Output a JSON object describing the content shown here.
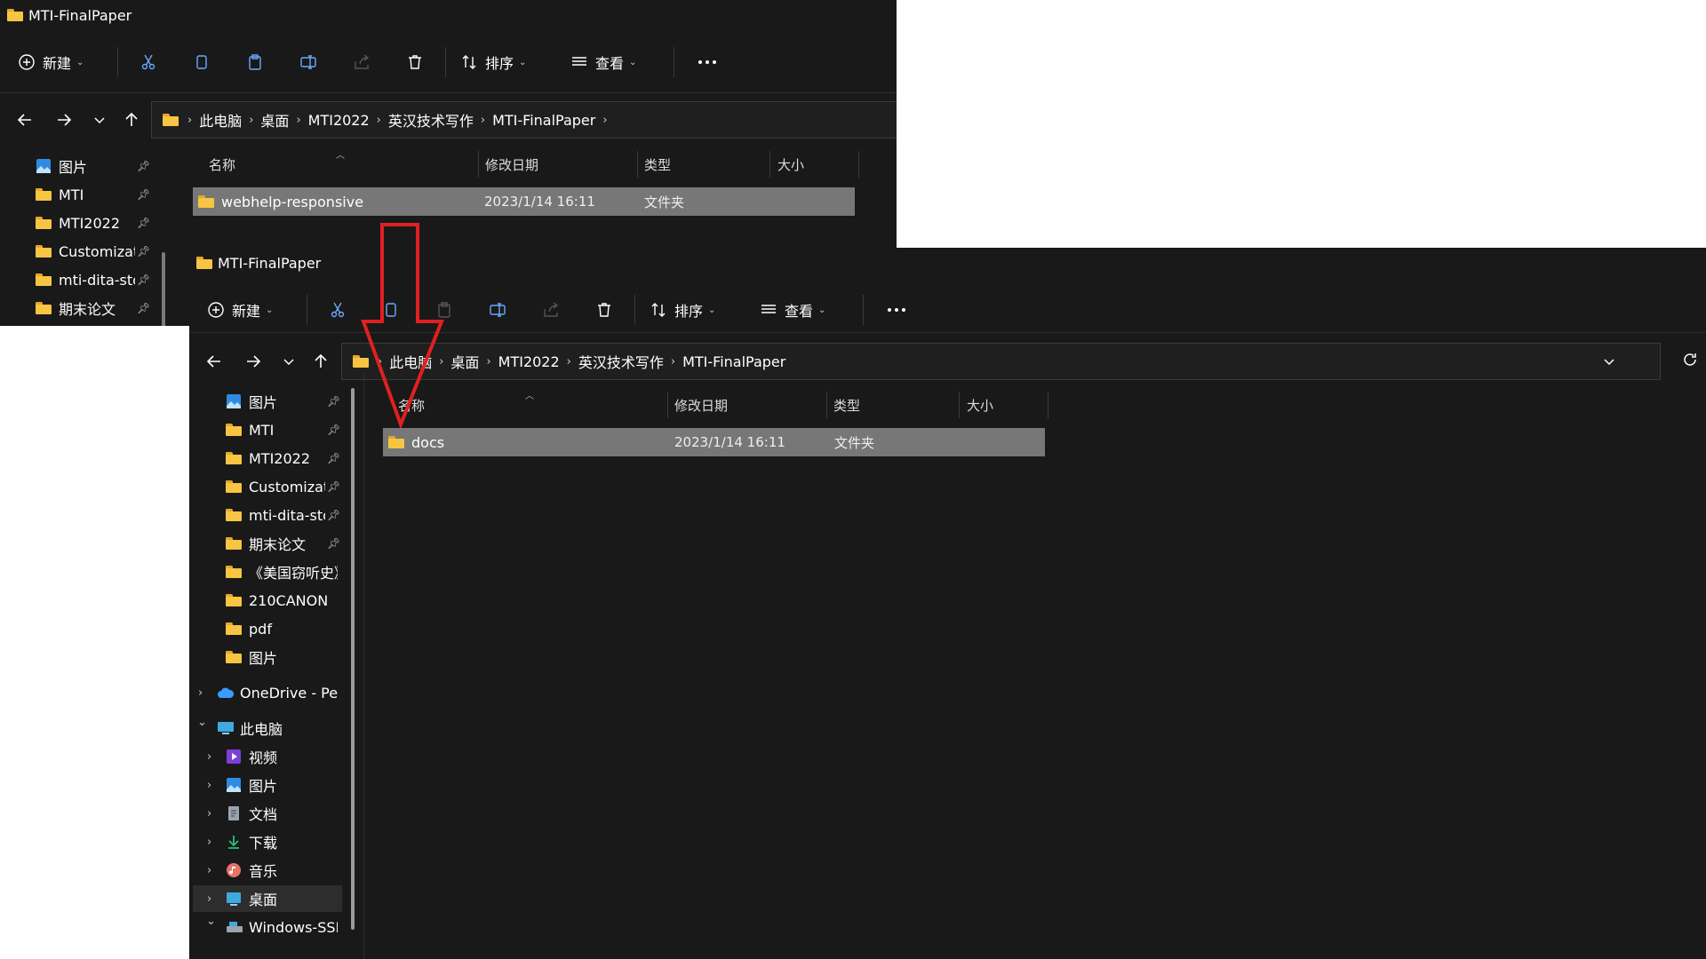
{
  "window_back": {
    "title": "MTI-FinalPaper",
    "toolbar": {
      "new_label": "新建",
      "sort_label": "排序",
      "view_label": "查看"
    },
    "breadcrumb": [
      "此电脑",
      "桌面",
      "MTI2022",
      "英汉技术写作",
      "MTI-FinalPaper"
    ],
    "sidebar": [
      {
        "label": "图片",
        "icon": "pictures-icon",
        "pinned": true
      },
      {
        "label": "MTI",
        "icon": "folder-icon",
        "pinned": true
      },
      {
        "label": "MTI2022",
        "icon": "folder-icon",
        "pinned": true
      },
      {
        "label": "Customizati",
        "icon": "folder-icon",
        "pinned": true
      },
      {
        "label": "mti-dita-sto",
        "icon": "folder-icon",
        "pinned": true
      },
      {
        "label": "期末论文",
        "icon": "folder-icon",
        "pinned": true
      }
    ],
    "columns": {
      "name": "名称",
      "modified": "修改日期",
      "type": "类型",
      "size": "大小"
    },
    "files": [
      {
        "name": "webhelp-responsive",
        "modified": "2023/1/14 16:11",
        "type": "文件夹",
        "selected": true
      }
    ]
  },
  "window_front": {
    "title": "MTI-FinalPaper",
    "toolbar": {
      "new_label": "新建",
      "sort_label": "排序",
      "view_label": "查看"
    },
    "breadcrumb": [
      "此电脑",
      "桌面",
      "MTI2022",
      "英汉技术写作",
      "MTI-FinalPaper"
    ],
    "sidebar": [
      {
        "label": "图片",
        "icon": "pictures-icon",
        "pinned": true
      },
      {
        "label": "MTI",
        "icon": "folder-icon",
        "pinned": true
      },
      {
        "label": "MTI2022",
        "icon": "folder-icon",
        "pinned": true
      },
      {
        "label": "Customizati",
        "icon": "folder-icon",
        "pinned": true
      },
      {
        "label": "mti-dita-sto",
        "icon": "folder-icon",
        "pinned": true
      },
      {
        "label": "期末论文",
        "icon": "folder-icon",
        "pinned": true
      },
      {
        "label": "《美国窃听史》",
        "icon": "folder-icon",
        "pinned": true
      },
      {
        "label": "210CANON",
        "icon": "folder-icon"
      },
      {
        "label": "pdf",
        "icon": "folder-icon"
      },
      {
        "label": "图片",
        "icon": "folder-icon"
      },
      {
        "label": "OneDrive - Perso",
        "icon": "onedrive-icon",
        "expandable": true
      },
      {
        "label": "此电脑",
        "icon": "this-pc-icon",
        "expanded": true
      },
      {
        "label": "视频",
        "icon": "videos-icon",
        "expandable": true
      },
      {
        "label": "图片",
        "icon": "pictures-icon",
        "expandable": true
      },
      {
        "label": "文档",
        "icon": "documents-icon",
        "expandable": true
      },
      {
        "label": "下载",
        "icon": "downloads-icon",
        "expandable": true
      },
      {
        "label": "音乐",
        "icon": "music-icon",
        "expandable": true
      },
      {
        "label": "桌面",
        "icon": "desktop-icon",
        "expandable": true,
        "selected": true
      },
      {
        "label": "Windows-SSD (",
        "icon": "drive-icon",
        "expanded": true
      }
    ],
    "columns": {
      "name": "名称",
      "modified": "修改日期",
      "type": "类型",
      "size": "大小"
    },
    "files": [
      {
        "name": "docs",
        "modified": "2023/1/14 16:11",
        "type": "文件夹",
        "selected": true
      }
    ]
  },
  "annotation": {
    "color": "#e02020"
  }
}
